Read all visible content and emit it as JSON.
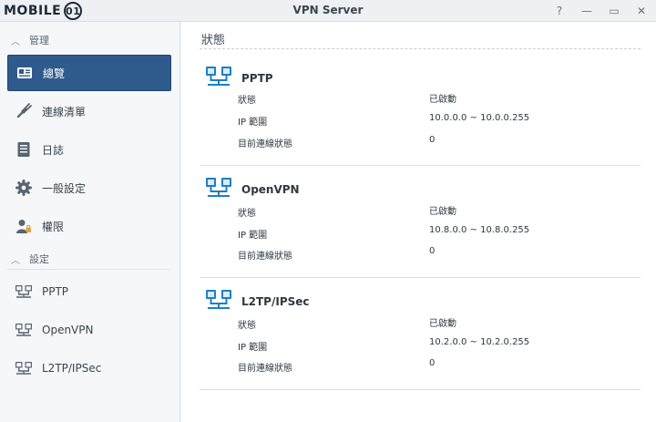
{
  "window": {
    "logo_text": "MOBILE",
    "logo_badge": "01",
    "title": "VPN Server",
    "controls": [
      "?",
      "—",
      "▭",
      "✕"
    ]
  },
  "sidebar": {
    "manage_label": "管理",
    "settings_label": "設定",
    "manage_items": [
      {
        "label": "總覽",
        "icon": "overview-icon",
        "active": true
      },
      {
        "label": "連線清單",
        "icon": "connection-list-icon",
        "active": false
      },
      {
        "label": "日誌",
        "icon": "log-icon",
        "active": false
      },
      {
        "label": "一般設定",
        "icon": "gear-icon",
        "active": false
      },
      {
        "label": "權限",
        "icon": "user-permission-icon",
        "active": false
      }
    ],
    "settings_items": [
      {
        "label": "PPTP",
        "icon": "network-icon"
      },
      {
        "label": "OpenVPN",
        "icon": "network-icon"
      },
      {
        "label": "L2TP/IPSec",
        "icon": "network-icon"
      }
    ]
  },
  "main": {
    "title": "狀態",
    "panels": [
      {
        "name": "PPTP",
        "rows": [
          {
            "label": "狀態",
            "value": "已啟動"
          },
          {
            "label": "IP 範圍",
            "value": "10.0.0.0 ~ 10.0.0.255"
          },
          {
            "label": "目前連線狀態",
            "value": "0"
          }
        ]
      },
      {
        "name": "OpenVPN",
        "rows": [
          {
            "label": "狀態",
            "value": "已啟動"
          },
          {
            "label": "IP 範圍",
            "value": "10.8.0.0 ~ 10.8.0.255"
          },
          {
            "label": "目前連線狀態",
            "value": "0"
          }
        ]
      },
      {
        "name": "L2TP/IPSec",
        "rows": [
          {
            "label": "狀態",
            "value": "已啟動"
          },
          {
            "label": "IP 範圍",
            "value": "10.2.0.0 ~ 10.2.0.255"
          },
          {
            "label": "目前連線狀態",
            "value": "0"
          }
        ]
      }
    ]
  }
}
